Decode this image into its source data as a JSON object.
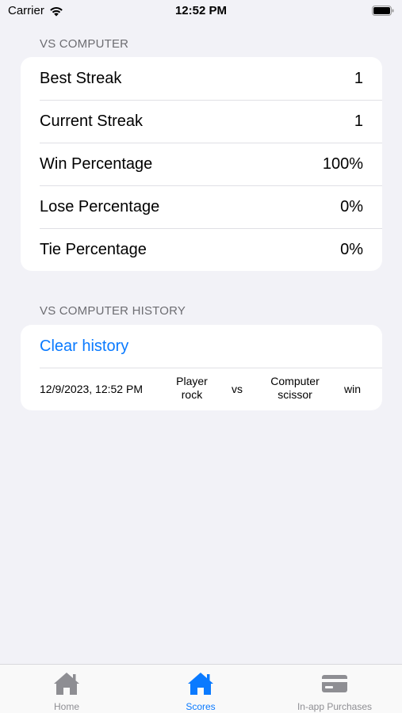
{
  "status_bar": {
    "carrier": "Carrier",
    "time": "12:52 PM"
  },
  "vs_computer": {
    "header": "VS COMPUTER",
    "stats": [
      {
        "label": "Best Streak",
        "value": "1"
      },
      {
        "label": "Current Streak",
        "value": "1"
      },
      {
        "label": "Win Percentage",
        "value": "100%"
      },
      {
        "label": "Lose Percentage",
        "value": "0%"
      },
      {
        "label": "Tie Percentage",
        "value": "0%"
      }
    ]
  },
  "history": {
    "header": "VS COMPUTER HISTORY",
    "clear_label": "Clear history",
    "entries": [
      {
        "date": "12/9/2023, 12:52 PM",
        "player_title": "Player",
        "player_move": "rock",
        "vs": "vs",
        "computer_title": "Computer",
        "computer_move": "scissor",
        "result": "win"
      }
    ]
  },
  "tab_bar": {
    "tabs": [
      {
        "label": "Home",
        "icon": "house-icon",
        "active": false
      },
      {
        "label": "Scores",
        "icon": "house-icon",
        "active": true
      },
      {
        "label": "In-app Purchases",
        "icon": "credit-card-icon",
        "active": false
      }
    ]
  },
  "colors": {
    "accent": "#0a7aff",
    "background": "#f2f2f7",
    "card": "#ffffff",
    "inactive": "#8e8e93"
  }
}
